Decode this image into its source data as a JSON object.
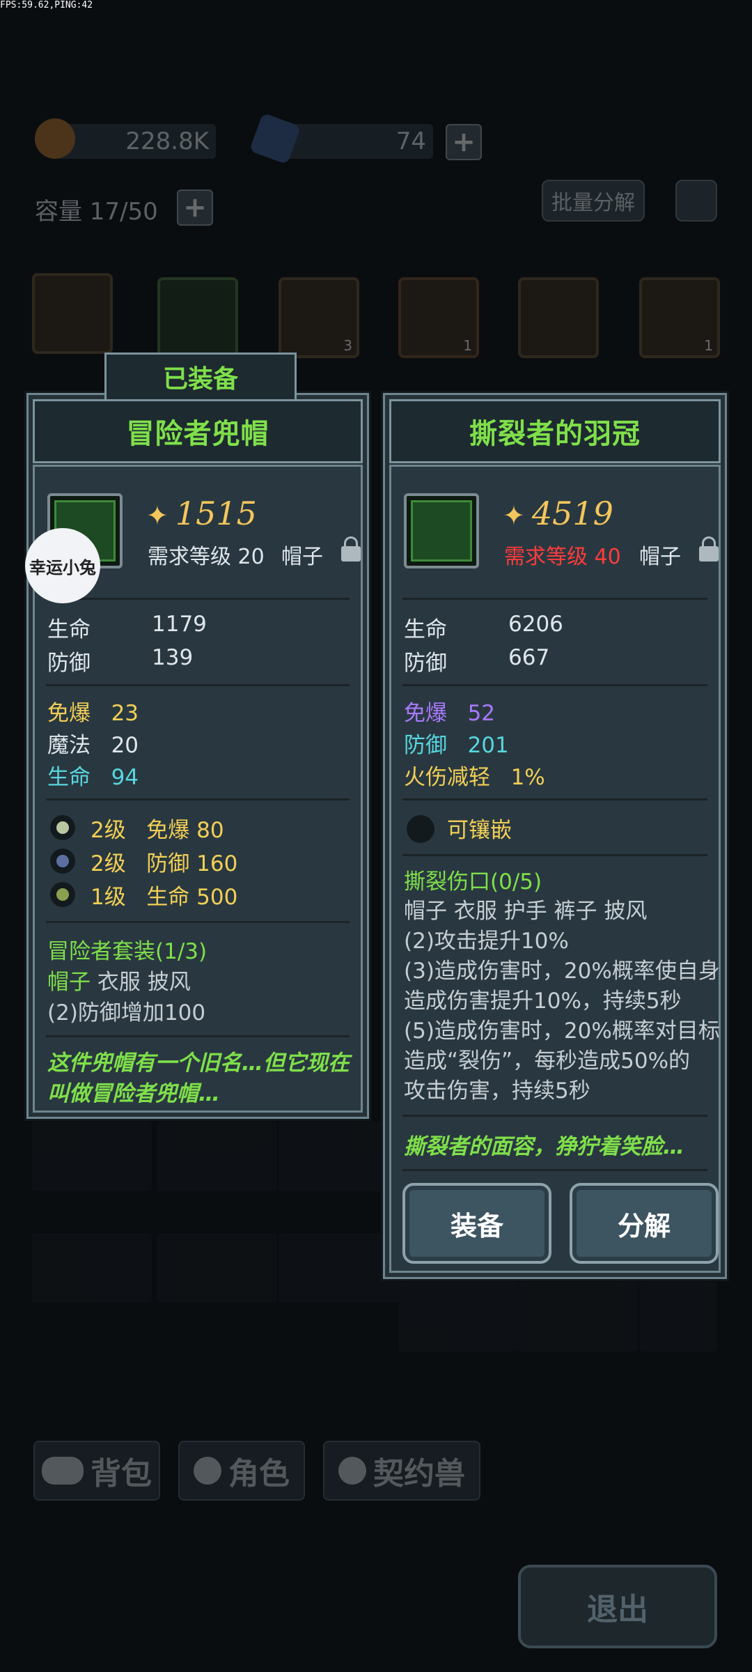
{
  "status": {
    "fps_text": "FPS:59.62,PING:42"
  },
  "resources": {
    "gold": "228.8K",
    "crystal": "74"
  },
  "capacity": {
    "label": "容量 17/50"
  },
  "batch_decompose": "批量分解",
  "item_slots": [
    {
      "count": ""
    },
    {
      "count": ""
    },
    {
      "count": "3"
    },
    {
      "count": "1"
    },
    {
      "count": ""
    },
    {
      "count": "1"
    }
  ],
  "equipped_tag": "已装备",
  "left_panel": {
    "title": "冒险者兜帽",
    "power": "1515",
    "requirement": "需求等级 20",
    "slot": "帽子",
    "base_stats": [
      {
        "name": "生命",
        "value": "1179"
      },
      {
        "name": "防御",
        "value": "139"
      }
    ],
    "extra_stats": [
      {
        "name": "免爆",
        "value": "23",
        "color": "#f2cf56"
      },
      {
        "name": "魔法",
        "value": "20",
        "color": "#dfe6ec"
      },
      {
        "name": "生命",
        "value": "94",
        "color": "#58d6df"
      }
    ],
    "gems": [
      {
        "level": "2级",
        "name": "免爆",
        "value": "80",
        "color": "#b9c7a0"
      },
      {
        "level": "2级",
        "name": "防御",
        "value": "160",
        "color": "#5a6fa0"
      },
      {
        "level": "1级",
        "name": "生命",
        "value": "500",
        "color": "#8aa050"
      }
    ],
    "set_name": "冒险者套装(1/3)",
    "set_parts_active": "帽子",
    "set_parts_rest": " 衣服 披风",
    "set_bonus": "(2)防御增加100",
    "flavor": [
      "这件兜帽有一个旧名…但它现在",
      "叫做冒险者兜帽…"
    ],
    "watermark": "幸运小兔"
  },
  "right_panel": {
    "title": "撕裂者的羽冠",
    "power": "4519",
    "requirement": "需求等级 40",
    "slot": "帽子",
    "base_stats": [
      {
        "name": "生命",
        "value": "6206"
      },
      {
        "name": "防御",
        "value": "667"
      }
    ],
    "extra_stats": [
      {
        "name": "免爆",
        "value": "52",
        "color": "#a978ff"
      },
      {
        "name": "防御",
        "value": "201",
        "color": "#58d6df"
      },
      {
        "name": "火伤减轻",
        "value": "1%",
        "color": "#f2cf56"
      }
    ],
    "socket": "可镶嵌",
    "set_name": "撕裂伤口(0/5)",
    "set_parts": "帽子 衣服 护手 裤子 披风",
    "set_bonus_lines": [
      "(2)攻击提升10%",
      "(3)造成伤害时，20%概率使自身",
      "造成伤害提升10%，持续5秒",
      "(5)造成伤害时，20%概率对目标",
      "造成“裂伤”，每秒造成50%的",
      "攻击伤害，持续5秒"
    ],
    "flavor": "撕裂者的面容，狰狞着笑脸…",
    "equip_button": "装备",
    "decompose_button": "分解"
  },
  "tabs": [
    {
      "label": "背包"
    },
    {
      "label": "角色"
    },
    {
      "label": "契约兽"
    }
  ],
  "exit_button": "退出",
  "colors": {
    "accent_green": "#7fe04a",
    "warn_red": "#ff3b3b",
    "gold": "#f4c65c"
  }
}
